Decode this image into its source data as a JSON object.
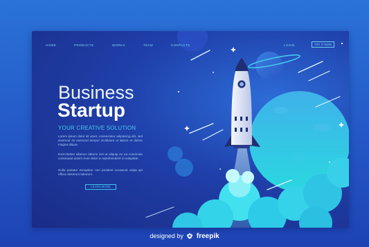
{
  "nav": {
    "items": [
      {
        "label": "HOME"
      },
      {
        "label": "PRODUCTS"
      },
      {
        "label": "WORKS"
      },
      {
        "label": "TEAM"
      },
      {
        "label": "CONTACTS"
      }
    ],
    "login": "LOGIN",
    "cta": "TRY IT NOW"
  },
  "hero": {
    "title_line1": "Business",
    "title_line2": "Startup",
    "tagline": "YOUR CREATIVE SOLUTION",
    "paragraphs": [
      "Lorem ipsum dolor sit amet, consectetur adipiscing elit, sed eiusmod do eiusmod tempor incididunt ut labore et dolore magna aliqua.",
      "Exercitation ullamco laboris nisi ut aliquip ex ea commodo consequat autem irure dolor in reprehenderit in voluptate.",
      "Nulla pariatur excepteur non proident occaecat culpa qui officia deserunt laborum."
    ],
    "button": "LEARN MORE"
  },
  "credit": {
    "prefix": "designed by",
    "brand": "freepik"
  },
  "colors": {
    "background": "#2458c6",
    "panel": "#1f3fa9",
    "accent": "#49c8f0",
    "cloud": "#2fd6e8",
    "planet": "#3aa6e6"
  },
  "icons": [
    "rocket-illustration",
    "planet-illustration",
    "star-icon",
    "freepik-logo-icon"
  ]
}
